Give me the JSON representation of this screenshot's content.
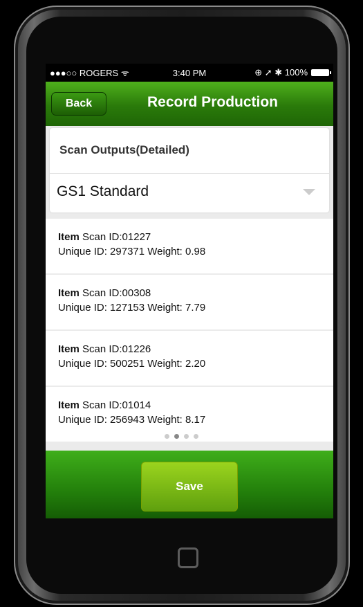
{
  "status_bar": {
    "carrier": "●●●○○ ROGERS ᯤ",
    "time": "3:40 PM",
    "right_icons": "⊕ ➚ ✱ 100%"
  },
  "nav": {
    "back_label": "Back",
    "title": "Record Production"
  },
  "scan": {
    "label": "Scan Outputs(Detailed)",
    "selected": "GS1 Standard"
  },
  "items": [
    {
      "prefix": "Item",
      "scan": "Scan ID:01227",
      "detail": "Unique ID: 297371 Weight: 0.98"
    },
    {
      "prefix": "Item",
      "scan": "Scan ID:00308",
      "detail": "Unique ID: 127153 Weight: 7.79"
    },
    {
      "prefix": "Item",
      "scan": "Scan ID:01226",
      "detail": "Unique ID: 500251 Weight: 2.20"
    },
    {
      "prefix": "Item",
      "scan": "Scan ID:01014",
      "detail": "Unique ID: 256943 Weight: 8.17"
    }
  ],
  "footer": {
    "save_label": "Save"
  },
  "colors": {
    "nav_green": "#2a7a0a",
    "save_green": "#7cbb14"
  }
}
